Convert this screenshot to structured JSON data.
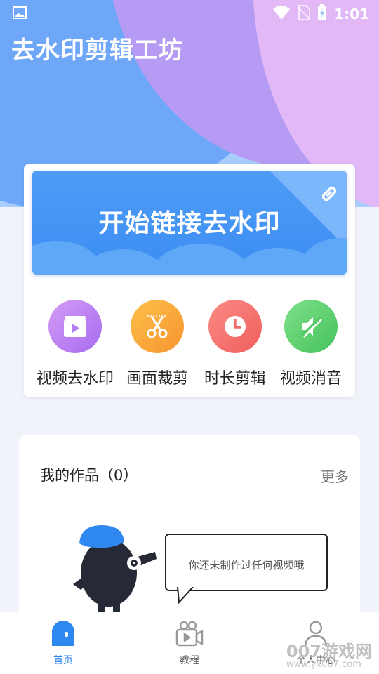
{
  "status_bar": {
    "time": "1:01"
  },
  "app_title": "去水印剪辑工坊",
  "banner": {
    "label": "开始链接去水印"
  },
  "tools": [
    {
      "label": "视频去水印",
      "icon": "video-play-icon",
      "color": "#b97ff0"
    },
    {
      "label": "画面裁剪",
      "icon": "scissors-icon",
      "color": "#f9a33a"
    },
    {
      "label": "时长剪辑",
      "icon": "clock-icon",
      "color": "#f26b6b"
    },
    {
      "label": "视频消音",
      "icon": "mute-icon",
      "color": "#5bd06a"
    }
  ],
  "works": {
    "title": "我的作品（0）",
    "more": "更多",
    "empty_text": "你还未制作过任何视频哦"
  },
  "nav": [
    {
      "label": "首页",
      "icon": "home-icon",
      "active": true
    },
    {
      "label": "教程",
      "icon": "video-camera-icon",
      "active": false
    },
    {
      "label": "个人中心",
      "icon": "person-icon",
      "active": false
    }
  ],
  "watermark": {
    "text": "007游戏网",
    "sub": "www.yx007.com"
  },
  "colors": {
    "accent": "#2f87f0",
    "banner": "#3b8df2"
  }
}
